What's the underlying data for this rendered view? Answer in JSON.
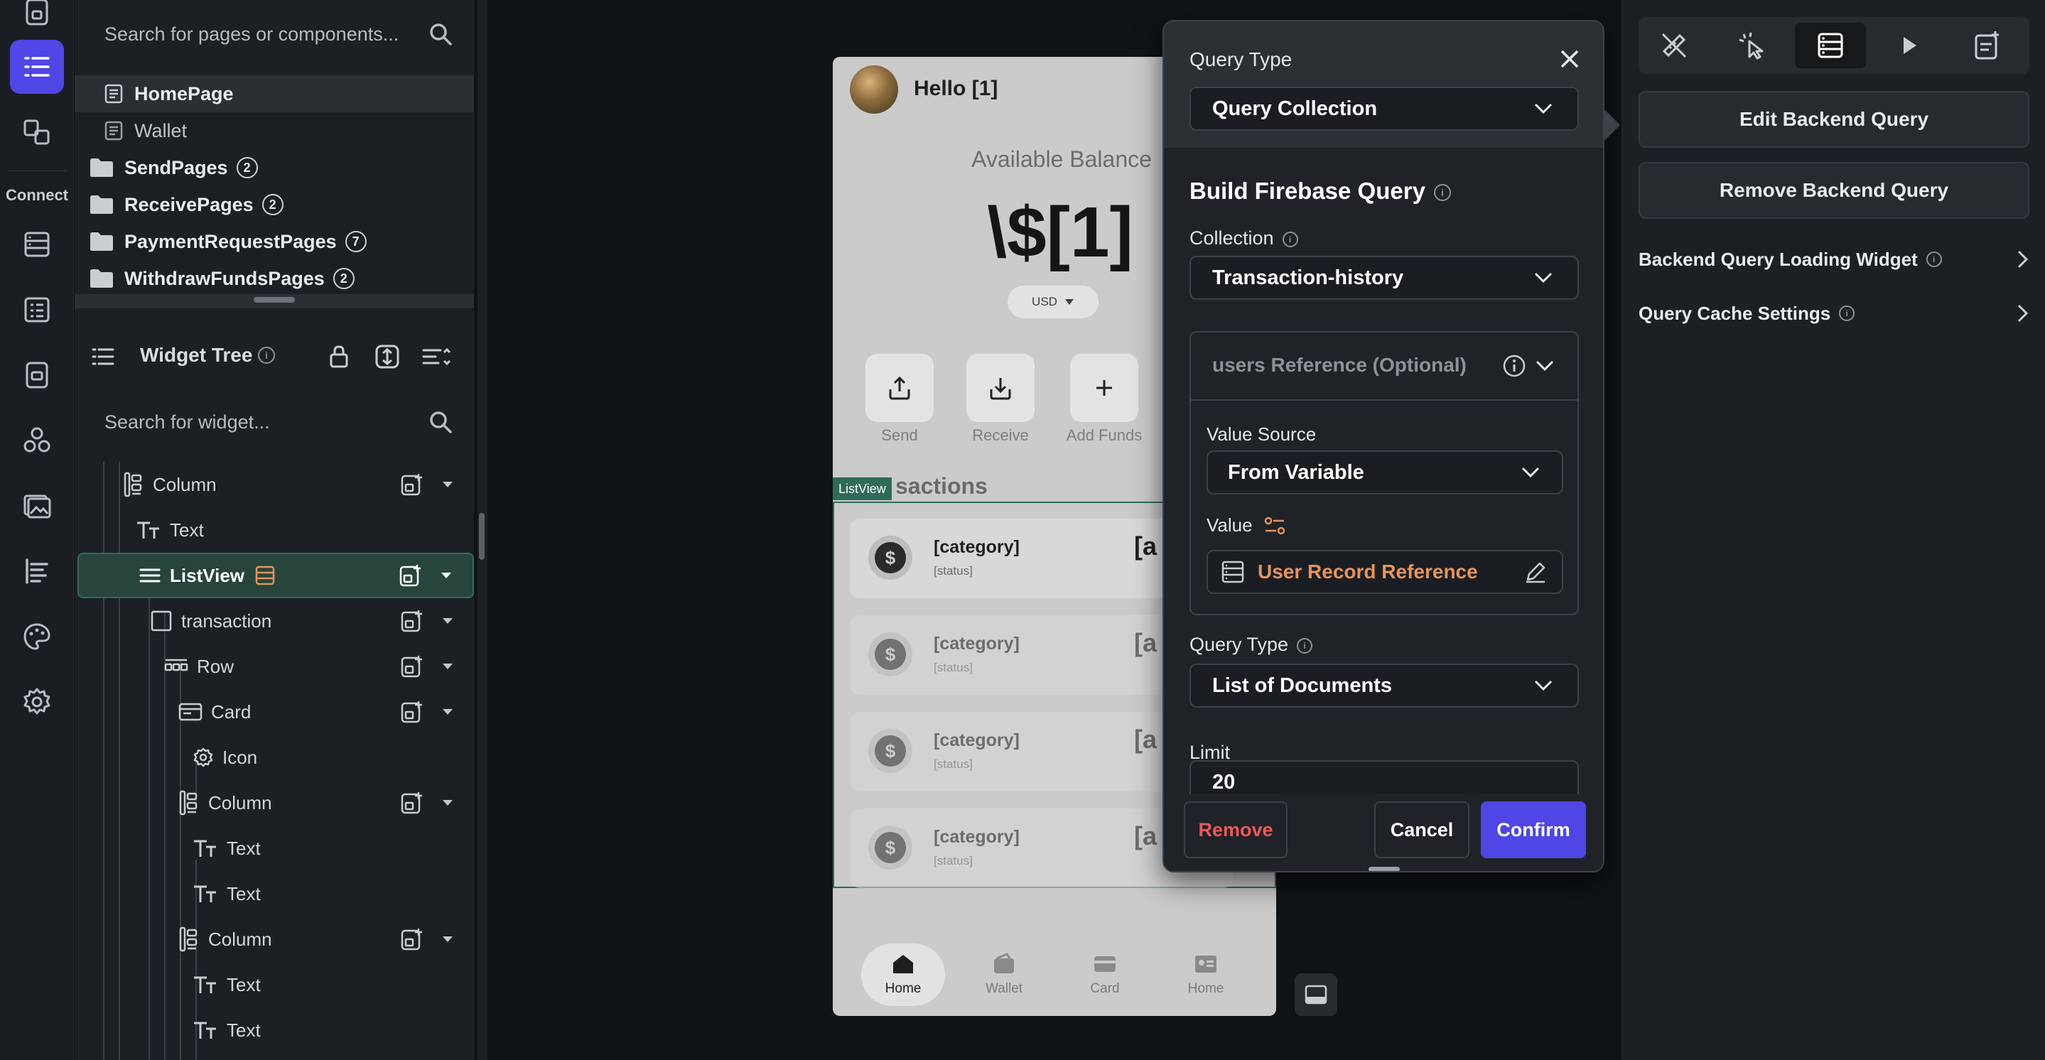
{
  "left_panel": {
    "page_search_placeholder": "Search for pages or components...",
    "pages": [
      {
        "label": "HomePage",
        "selected": true
      },
      {
        "label": "Wallet",
        "selected": false
      }
    ],
    "folders": [
      {
        "label": "SendPages",
        "count": "2"
      },
      {
        "label": "ReceivePages",
        "count": "2"
      },
      {
        "label": "PaymentRequestPages",
        "count": "7"
      },
      {
        "label": "WithdrawFundsPages",
        "count": "2"
      }
    ],
    "widget_tree_title": "Widget Tree",
    "widget_search_placeholder": "Search for widget...",
    "tree": [
      {
        "label": "Column",
        "icon": "column-icon"
      },
      {
        "label": "Text",
        "icon": "text-icon"
      },
      {
        "label": "ListView",
        "icon": "listview-icon",
        "selected": true
      },
      {
        "label": "transaction",
        "icon": "container-icon"
      },
      {
        "label": "Row",
        "icon": "row-icon"
      },
      {
        "label": "Card",
        "icon": "card-icon"
      },
      {
        "label": "Icon",
        "icon": "gear-icon"
      },
      {
        "label": "Column",
        "icon": "column-icon"
      },
      {
        "label": "Text",
        "icon": "text-icon"
      },
      {
        "label": "Text",
        "icon": "text-icon"
      },
      {
        "label": "Column",
        "icon": "column-icon"
      },
      {
        "label": "Text",
        "icon": "text-icon"
      },
      {
        "label": "Text",
        "icon": "text-icon"
      }
    ]
  },
  "rail": {
    "connect_label": "Connect"
  },
  "phone": {
    "greeting": "Hello [1]",
    "available_balance": "Available Balance",
    "balance": "\\$[1]",
    "currency": "USD",
    "actions": [
      "Send",
      "Receive",
      "Add Funds"
    ],
    "listview_tag": "ListView",
    "transactions_heading": "sactions",
    "transactions": [
      {
        "category": "[category]",
        "status": "[status]",
        "amount": "[a"
      },
      {
        "category": "[category]",
        "status": "[status]",
        "amount": "[a"
      },
      {
        "category": "[category]",
        "status": "[status]",
        "amount": "[a"
      },
      {
        "category": "[category]",
        "status": "[status]",
        "amount": "[a"
      }
    ],
    "nav": [
      "Home",
      "Wallet",
      "Card",
      "Home"
    ]
  },
  "query_popup": {
    "query_type_label": "Query Type",
    "query_type_value": "Query Collection",
    "build_title": "Build Firebase Query",
    "collection_label": "Collection",
    "collection_value": "Transaction-history",
    "reference_title": "users Reference (Optional)",
    "value_source_label": "Value Source",
    "value_source_value": "From Variable",
    "value_label": "Value",
    "value_value": "User Record Reference",
    "query_type2_label": "Query Type",
    "query_type2_value": "List of Documents",
    "limit_label": "Limit",
    "limit_value": "20",
    "remove_label": "Remove",
    "cancel_label": "Cancel",
    "confirm_label": "Confirm"
  },
  "right_panel": {
    "edit_backend_query": "Edit Backend Query",
    "remove_backend_query": "Remove Backend Query",
    "loading_widget": "Backend Query Loading Widget",
    "cache_settings": "Query Cache Settings"
  },
  "colors": {
    "accent": "#4f46e5",
    "danger": "#ef5757",
    "selection_green": "#2f6b5a",
    "variable_orange": "#e8935a"
  }
}
